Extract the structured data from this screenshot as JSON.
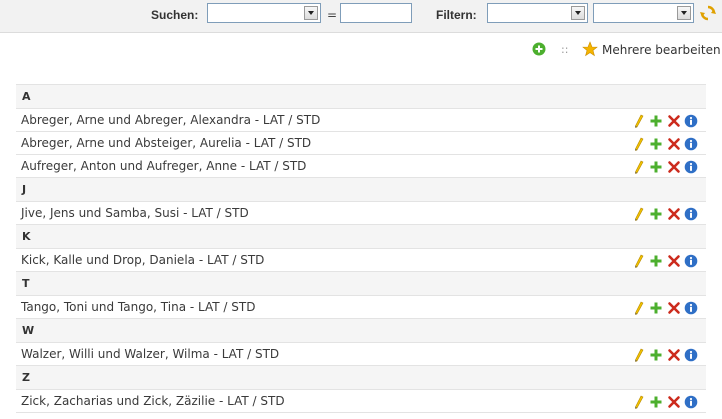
{
  "toolbar": {
    "search_label": "Suchen:",
    "equals": "=",
    "search_value": "",
    "filter_label": "Filtern:"
  },
  "actions": {
    "separator": "::",
    "bulk_edit_label": "Mehrere bearbeiten"
  },
  "groups": [
    {
      "letter": "A",
      "items": [
        "Abreger, Arne und Abreger, Alexandra - LAT / STD",
        "Abreger, Arne und Absteiger, Aurelia - LAT / STD",
        "Aufreger, Anton und Aufreger, Anne - LAT / STD"
      ]
    },
    {
      "letter": "J",
      "items": [
        "Jive, Jens und Samba, Susi - LAT / STD"
      ]
    },
    {
      "letter": "K",
      "items": [
        "Kick, Kalle und Drop, Daniela - LAT / STD"
      ]
    },
    {
      "letter": "T",
      "items": [
        "Tango, Toni und Tango, Tina - LAT / STD"
      ]
    },
    {
      "letter": "W",
      "items": [
        "Walzer, Willi und Walzer, Wilma - LAT / STD"
      ]
    },
    {
      "letter": "Z",
      "items": [
        "Zick, Zacharias und Zick, Zäzilie - LAT / STD"
      ]
    }
  ],
  "row_icons": [
    "edit-pencil-icon",
    "add-plus-icon",
    "delete-x-icon",
    "info-icon"
  ],
  "colors": {
    "toolbar_bg": "#f2f2f2",
    "group_bg": "#f5f5f5",
    "plus_green": "#4caf2e",
    "delete_red": "#cc2b1d",
    "info_blue": "#2f6fc6",
    "pencil_yellow": "#e6b000"
  }
}
